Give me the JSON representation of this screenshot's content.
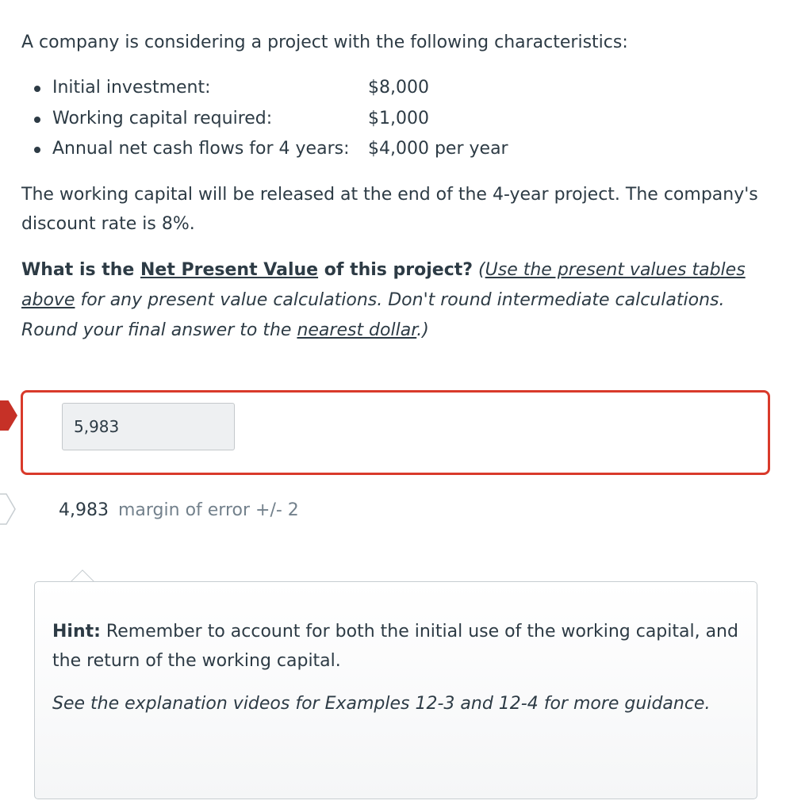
{
  "intro": "A company is considering a project with the following characteristics:",
  "characteristics": [
    {
      "label": "Initial investment:",
      "value": "$8,000"
    },
    {
      "label": "Working capital required:",
      "value": "$1,000"
    },
    {
      "label": "Annual net cash flows for 4 years:",
      "value": "$4,000 per year"
    }
  ],
  "paragraph": "The working capital will be released at the end of the 4-year project.  The company's discount rate is 8%.",
  "question": {
    "lead": "What is the ",
    "npv_link": "Net Present Value",
    "tail": " of this project?",
    "instr_open": " (",
    "instr_link": "Use the present values tables above",
    "instr_mid": " for any present value calculations.  Don't round intermediate calculations. Round your final answer to the ",
    "instr_link2": "nearest dollar",
    "instr_close": ".)"
  },
  "answer": {
    "entered_value": "5,983",
    "status_color": "#d93a2b"
  },
  "correct": {
    "value": "4,983",
    "margin_text": "margin of error +/- 2"
  },
  "hint": {
    "label": "Hint:",
    "text": " Remember to account for both the initial use of the working capital, and the return of the working capital.",
    "guidance": "See the explanation videos for Examples 12-3 and 12-4 for more guidance."
  }
}
